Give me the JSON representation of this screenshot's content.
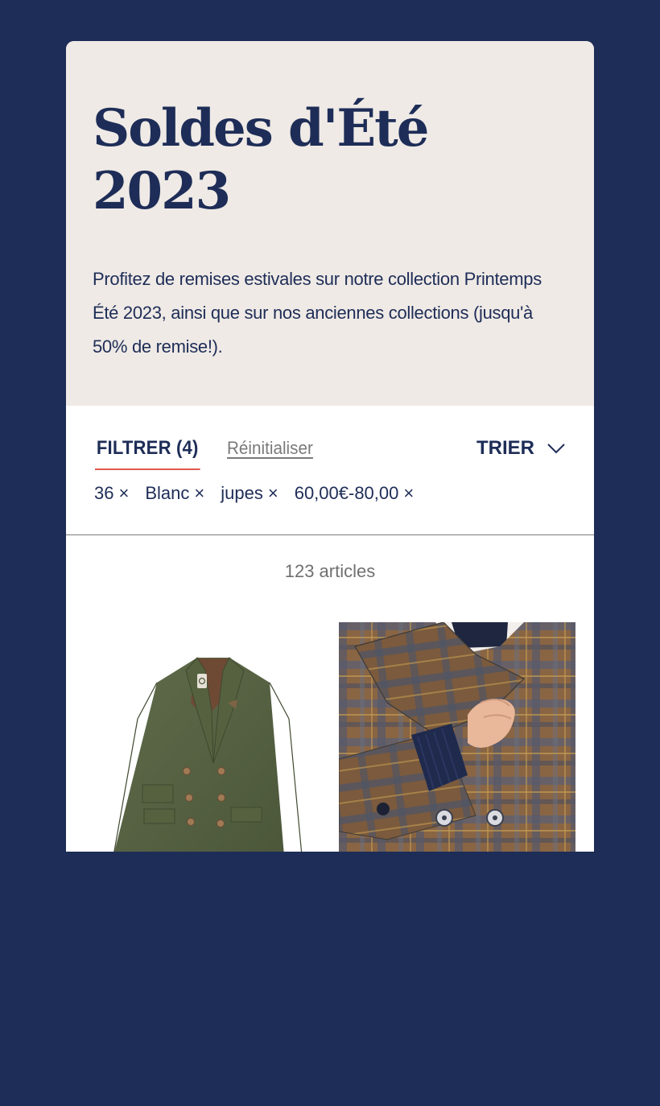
{
  "hero": {
    "title": "Soldes d'Été 2023",
    "description": "Profitez de remises estivales sur notre collection Printemps Été 2023, ainsi que sur nos anciennes collections (jusqu'à 50% de remise!)."
  },
  "toolbar": {
    "filter_label": "FILTRER (4)",
    "reset_label": "Réinitialiser",
    "sort_label": "TRIER",
    "sort_icon": "chevron-down-icon",
    "filter_chips": [
      {
        "label": "36",
        "remove": "×"
      },
      {
        "label": "Blanc",
        "remove": "×"
      },
      {
        "label": "jupes",
        "remove": "×"
      },
      {
        "label": "60,00€-80,00",
        "remove": "×"
      }
    ]
  },
  "results": {
    "count_text": "123 articles"
  },
  "products": [
    {
      "image": "green-double-breasted-blazer"
    },
    {
      "image": "plaid-wool-coat-on-model"
    }
  ],
  "colors": {
    "page_background": "#1e2d57",
    "hero_background": "#efeae6",
    "brand_navy": "#1e2d57",
    "filter_underline": "#e0574f",
    "muted_text": "#7a7a7a"
  }
}
